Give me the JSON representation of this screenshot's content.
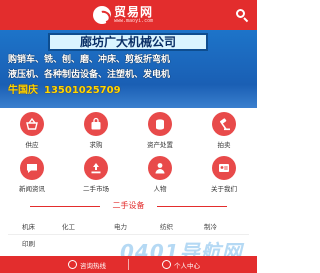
{
  "header": {
    "logo_title": "贸易网",
    "logo_domain": "www.maoyi.com"
  },
  "banner": {
    "title": "廊坊广大机械公司",
    "line1": "购销车、铣、刨、磨、冲床、剪板折弯机",
    "line2": "液压机、各种制齿设备、注塑机、发电机",
    "contact_name": "牛国庆",
    "contact_phone": "13501025709",
    "slides": 5,
    "active_slide": 0
  },
  "categories": [
    {
      "label": "供应",
      "icon": "basket-icon",
      "color": "#e84a4a"
    },
    {
      "label": "求购",
      "icon": "shopping-bag-icon",
      "color": "#e84a4a"
    },
    {
      "label": "资产处置",
      "icon": "coin-stack-icon",
      "color": "#e84a4a"
    },
    {
      "label": "拍卖",
      "icon": "gavel-icon",
      "color": "#e84a4a"
    },
    {
      "label": "新闻资讯",
      "icon": "chat-icon",
      "color": "#e84a4a"
    },
    {
      "label": "二手市场",
      "icon": "recycle-icon",
      "color": "#e84a4a"
    },
    {
      "label": "人物",
      "icon": "person-icon",
      "color": "#e84a4a"
    },
    {
      "label": "关于我们",
      "icon": "id-card-icon",
      "color": "#e84a4a"
    }
  ],
  "section": {
    "title": "二手设备"
  },
  "equipment": [
    "机床",
    "化工",
    "电力",
    "纺织",
    "制冷",
    "印刷"
  ],
  "watermark": "0401导航网",
  "bottom_bar": {
    "left_label": "咨询热线",
    "right_label": "个人中心"
  },
  "colors": {
    "brand_red": "#e32d2d",
    "banner_blue": "#1a5fb4",
    "contact_yellow": "#ffd800"
  }
}
